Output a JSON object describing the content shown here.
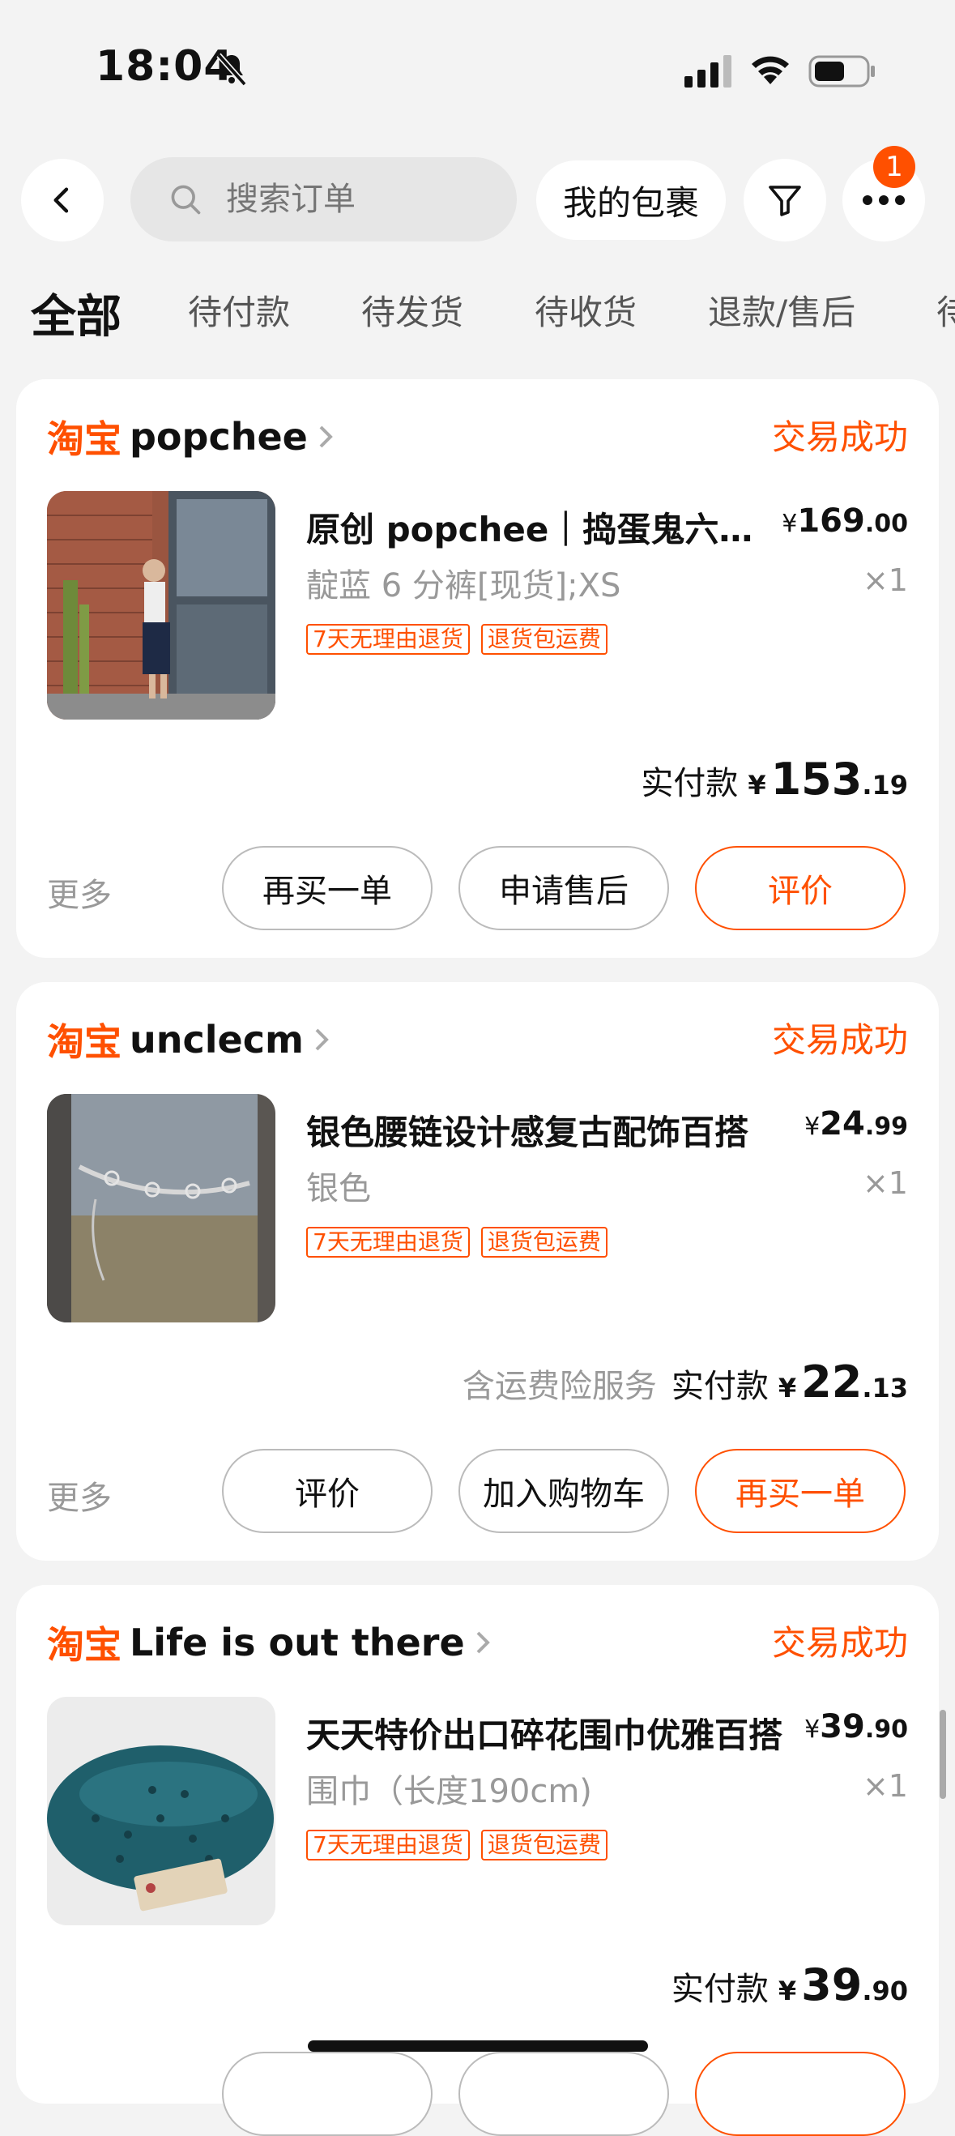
{
  "status_bar": {
    "time": "18:04"
  },
  "header": {
    "search_placeholder": "搜索订单",
    "my_packages_label": "我的包裹",
    "more_badge_count": "1"
  },
  "tabs": [
    "全部",
    "待付款",
    "待发货",
    "待收货",
    "退款/售后",
    "待"
  ],
  "colors": {
    "accent": "#ff5000",
    "background": "#f3f3f3"
  },
  "orders": [
    {
      "platform": "淘宝",
      "store": "popchee",
      "status": "交易成功",
      "title": "原创 popchee｜捣蛋鬼六分牛仔裤",
      "price_yen": "¥",
      "price_int": "169",
      "price_dec": ".00",
      "sku": "靛蓝 6 分裤[现货];XS",
      "qty": "×1",
      "tags": [
        "7天无理由退货",
        "退货包运费"
      ],
      "insurance": "",
      "paid_label": "实付款",
      "paid_int": "153",
      "paid_dec": ".19",
      "more_label": "更多",
      "buttons": [
        "再买一单",
        "申请售后",
        "评价"
      ]
    },
    {
      "platform": "淘宝",
      "store": "unclecm",
      "status": "交易成功",
      "title": "银色腰链设计感复古配饰百搭",
      "price_yen": "¥",
      "price_int": "24",
      "price_dec": ".99",
      "sku": "银色",
      "qty": "×1",
      "tags": [
        "7天无理由退货",
        "退货包运费"
      ],
      "insurance": "含运费险服务",
      "paid_label": "实付款",
      "paid_int": "22",
      "paid_dec": ".13",
      "more_label": "更多",
      "buttons": [
        "评价",
        "加入购物车",
        "再买一单"
      ]
    },
    {
      "platform": "淘宝",
      "store": "Life is out there",
      "status": "交易成功",
      "title": "天天特价出口碎花围巾优雅百搭",
      "price_yen": "¥",
      "price_int": "39",
      "price_dec": ".90",
      "sku": "围巾（长度190cm)",
      "qty": "×1",
      "tags": [
        "7天无理由退货",
        "退货包运费"
      ],
      "insurance": "",
      "paid_label": "实付款",
      "paid_int": "39",
      "paid_dec": ".90"
    }
  ]
}
